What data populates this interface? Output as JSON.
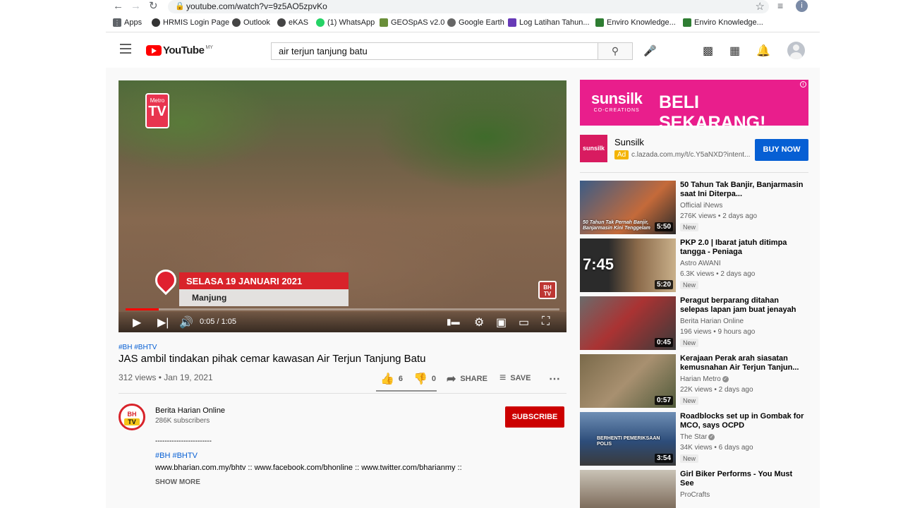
{
  "browser": {
    "url": "youtube.com/watch?v=9z5AO5zpvKo",
    "profile_initial": "i",
    "bookmarks": [
      {
        "label": "Apps"
      },
      {
        "label": "HRMIS Login Page"
      },
      {
        "label": "Outlook"
      },
      {
        "label": "eKAS"
      },
      {
        "label": "(1) WhatsApp"
      },
      {
        "label": "GEOSpAS v2.0"
      },
      {
        "label": "Google Earth"
      },
      {
        "label": "Log Latihan Tahun..."
      },
      {
        "label": "Enviro Knowledge..."
      },
      {
        "label": "Enviro Knowledge..."
      }
    ]
  },
  "header": {
    "logo_text": "YouTube",
    "country": "MY",
    "search_value": "air terjun tanjung batu"
  },
  "player": {
    "overlay_date": "SELASA 19 JANUARI 2021",
    "overlay_place": "Manjung",
    "metro_badge": "Metro",
    "metro_letter": "TV",
    "bhtv_mark": "BH TV",
    "time": "0:05 / 1:05",
    "progress_fraction": 0.077
  },
  "video": {
    "tags": "#BH #BHTV",
    "title": "JAS ambil tindakan pihak cemar kawasan Air Terjun Tanjung Batu",
    "views_date": "312 views • Jan 19, 2021",
    "likes": "6",
    "dislikes": "0",
    "share_label": "SHARE",
    "save_label": "SAVE"
  },
  "channel": {
    "name": "Berita Harian Online",
    "subs": "286K subscribers",
    "logo_top": "BH",
    "logo_bottom": "TV",
    "subscribe_label": "SUBSCRIBE",
    "desc_rule": "------------------------",
    "desc_tags": "#BH #BHTV",
    "desc_links": "www.bharian.com.my/bhtv :: www.facebook.com/bhonline :: www.twitter.com/bharianmy ::",
    "show_more": "SHOW MORE"
  },
  "ad": {
    "brand": "sunsilk",
    "brand_sub": "CO-CREATIONS",
    "cta_text": "BELI SEKARANG!",
    "name": "Sunsilk",
    "tag": "Ad",
    "url": "c.lazada.com.my/t/c.Y5aNXD?intent...",
    "button": "BUY NOW",
    "logo_text": "sunsilk",
    "accent": "#e91e8c"
  },
  "recommendations": [
    {
      "title": "50 Tahun Tak Banjir, Banjarmasin saat Ini Diterpa...",
      "channel": "Official iNews",
      "verified": false,
      "meta": "276K views • 2 days ago",
      "badge": "New",
      "duration": "5:50",
      "thumb_caption": "50 Tahun Tak Pernah Banjir, Banjarmasin Kini Tenggelam",
      "thumb_big": ""
    },
    {
      "title": "PKP 2.0 | Ibarat jatuh ditimpa tangga - Peniaga",
      "channel": "Astro AWANI",
      "verified": false,
      "meta": "6.3K views • 2 days ago",
      "badge": "New",
      "duration": "5:20",
      "thumb_caption": "",
      "thumb_big": "7:45"
    },
    {
      "title": "Peragut berparang ditahan selepas lapan jam buat jenayah",
      "channel": "Berita Harian Online",
      "verified": false,
      "meta": "196 views • 9 hours ago",
      "badge": "New",
      "duration": "0:45",
      "thumb_caption": "",
      "thumb_big": ""
    },
    {
      "title": "Kerajaan Perak arah siasatan kemusnahan Air Terjun Tanjun...",
      "channel": "Harian Metro",
      "verified": true,
      "meta": "22K views • 2 days ago",
      "badge": "New",
      "duration": "0:57",
      "thumb_caption": "",
      "thumb_big": ""
    },
    {
      "title": "Roadblocks set up in Gombak for MCO, says OCPD",
      "channel": "The Star",
      "verified": true,
      "meta": "34K views • 6 days ago",
      "badge": "New",
      "duration": "3:54",
      "thumb_caption": "BERHENTI PEMERIKSAAN POLIS",
      "thumb_big": ""
    },
    {
      "title": "Girl Biker Performs - You Must See",
      "channel": "ProCrafts",
      "verified": false,
      "meta": "",
      "badge": "",
      "duration": "",
      "thumb_caption": "",
      "thumb_big": ""
    }
  ]
}
